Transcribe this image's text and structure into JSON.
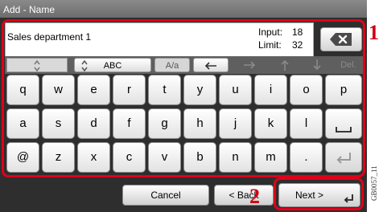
{
  "window": {
    "title": "Add - Name"
  },
  "input": {
    "text": "Sales department 1",
    "input_label": "Input:",
    "input_value": "18",
    "limit_label": "Limit:",
    "limit_value": "32"
  },
  "function_row": {
    "abc_label": "ABC",
    "case_label": "A/a",
    "delete_label": "Del."
  },
  "keyboard": {
    "row1": [
      "q",
      "w",
      "e",
      "r",
      "t",
      "y",
      "u",
      "i",
      "o",
      "p"
    ],
    "row2": [
      "a",
      "s",
      "d",
      "f",
      "g",
      "h",
      "j",
      "k",
      "l"
    ],
    "row3": [
      "@",
      "z",
      "x",
      "c",
      "v",
      "b",
      "n",
      "m",
      "."
    ]
  },
  "buttons": {
    "cancel": "Cancel",
    "back": "< Back",
    "next": "Next >"
  },
  "callouts": {
    "one": "1",
    "two": "2"
  },
  "side_code": "GB0057_11",
  "icons": {
    "backspace": "backspace-x-icon",
    "space": "space-bar-icon",
    "enter": "enter-return-icon",
    "left": "arrow-left-icon",
    "right": "arrow-right-icon",
    "up": "arrow-up-icon",
    "down": "arrow-down-icon",
    "toggle": "up-down-toggle-icon"
  },
  "colors": {
    "highlight": "#e0001a",
    "panel": "#2e2e2e"
  }
}
